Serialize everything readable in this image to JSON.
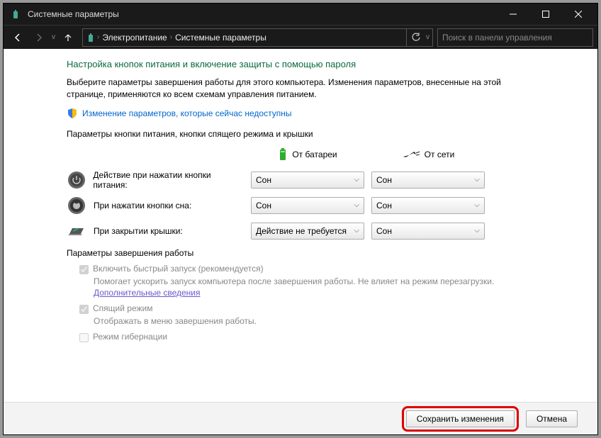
{
  "window": {
    "title": "Системные параметры",
    "breadcrumbs": [
      "Электропитание",
      "Системные параметры"
    ],
    "search_placeholder": "Поиск в панели управления"
  },
  "page": {
    "heading": "Настройка кнопок питания и включение защиты с помощью пароля",
    "description": "Выберите параметры завершения работы для этого компьютера. Изменения параметров, внесенные на этой странице, применяются ко всем схемам управления питанием.",
    "change_link": "Изменение параметров, которые сейчас недоступны"
  },
  "buttons_section": {
    "legend": "Параметры кнопки питания, кнопки спящего режима и крышки",
    "col_battery": "От батареи",
    "col_ac": "От сети",
    "rows": [
      {
        "label": "Действие при нажатии кнопки питания:",
        "battery": "Сон",
        "ac": "Сон"
      },
      {
        "label": "При нажатии кнопки сна:",
        "battery": "Сон",
        "ac": "Сон"
      },
      {
        "label": "При закрытии крышки:",
        "battery": "Действие не требуется",
        "ac": "Сон"
      }
    ]
  },
  "shutdown_section": {
    "legend": "Параметры завершения работы",
    "fast_startup": "Включить быстрый запуск (рекомендуется)",
    "fast_startup_sub": "Помогает ускорить запуск компьютера после завершения работы. Не влияет на режим перезагрузки.",
    "more_info": "Дополнительные сведения",
    "sleep": "Спящий режим",
    "sleep_sub": "Отображать в меню завершения работы.",
    "hibernate": "Режим гибернации"
  },
  "footer": {
    "save": "Сохранить изменения",
    "cancel": "Отмена"
  }
}
